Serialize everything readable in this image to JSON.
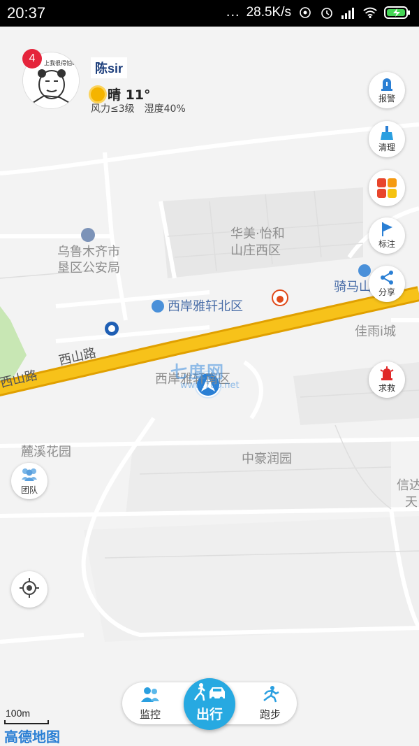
{
  "status_bar": {
    "time": "20:37",
    "more": "...",
    "speed": "28.5K/s"
  },
  "profile": {
    "badge_count": "4",
    "avatar_caption": "上我很得怕to",
    "name": "陈sir",
    "weather": "晴 11°",
    "wind": "风力≤3级",
    "humidity": "湿度40%"
  },
  "map": {
    "pois": [
      {
        "label": "乌鲁木齐市"
      },
      {
        "label": "垦区公安局"
      },
      {
        "label": "西岸雅轩北区"
      },
      {
        "label": "骑马山"
      }
    ],
    "areas": [
      {
        "label": "华美·怡和"
      },
      {
        "label": "山庄西区"
      },
      {
        "label": "佳雨i城"
      },
      {
        "label": "西岸雅轩南区"
      },
      {
        "label": "麓溪花园"
      },
      {
        "label": "中豪润园"
      },
      {
        "label": "信达"
      },
      {
        "label": "天"
      }
    ],
    "road_name": "西山路",
    "watermark": "七度网",
    "watermark_sub": "www.7do.net"
  },
  "right_buttons": {
    "alarm": "报警",
    "clean": "清理",
    "mark": "标注",
    "share": "分享",
    "sos": "求救"
  },
  "left_buttons": {
    "team": "团队"
  },
  "bottom_bar": {
    "monitor": "监控",
    "go": "出行",
    "run": "跑步"
  },
  "scale": "100m",
  "logo": "高德地图",
  "colors": {
    "road_yellow": "#f7c21a",
    "road_orange": "#f0a800",
    "accent_blue": "#27a9e1",
    "badge_red": "#e5243b"
  }
}
